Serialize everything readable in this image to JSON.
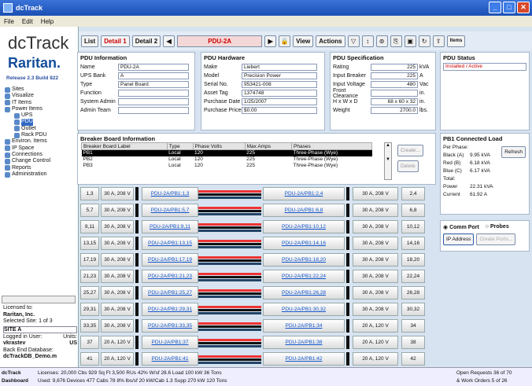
{
  "window": {
    "title": "dcTrack"
  },
  "menu": [
    "File",
    "Edit",
    "Help"
  ],
  "left": {
    "logo1": "dcTrack",
    "logo2": "Raritan.",
    "release": "Release 2.3 Build 822",
    "tree": [
      "Sites",
      "Visualize",
      "IT Items",
      "Power Items",
      "UPS",
      "PDU",
      "Outlet",
      "Rack PDU",
      "Environ. Items",
      "IP Space",
      "Connections",
      "Change Control",
      "Reports",
      "Administration"
    ],
    "licensed_to_label": "Licensed to:",
    "licensed_to": "Raritan, Inc.",
    "selected_site": "Selected Site: 1 of 3",
    "site": "SITE A",
    "logged_label": "Logged in User:",
    "logged_user": "vkrastev",
    "units_label": "Units:",
    "units": "US",
    "backend_label": "Back End Database:",
    "backend": "dcTrackDB_Demo.m"
  },
  "toolbar": {
    "list": "List",
    "detail1": "Detail 1",
    "detail2": "Detail 2",
    "pdu": "PDU-2A",
    "view": "View",
    "actions": "Actions",
    "items": "Items"
  },
  "pdu_info": {
    "title": "PDU Information",
    "fields": [
      [
        "Name",
        "PDU-2A"
      ],
      [
        "UPS Bank",
        "A"
      ],
      [
        "Type",
        "Panel Board"
      ],
      [
        "Function",
        ""
      ],
      [
        "System Admin",
        ""
      ],
      [
        "Admin Team",
        ""
      ]
    ]
  },
  "pdu_hw": {
    "title": "PDU Hardware",
    "fields": [
      [
        "Make",
        "Liebert"
      ],
      [
        "Model",
        "Precision Power"
      ],
      [
        "Serial No.",
        "953421-008"
      ],
      [
        "Asset Tag",
        "1374748"
      ],
      [
        "Purchase Date",
        "1/25/2007"
      ],
      [
        "Purchase Price",
        "$0.00"
      ]
    ]
  },
  "pdu_spec": {
    "title": "PDU Specification",
    "fields": [
      [
        "Rating",
        "225",
        "kVA"
      ],
      [
        "Input Breaker",
        "225",
        "A"
      ],
      [
        "Input Voltage",
        "480",
        "Vac"
      ],
      [
        "Front Clearance",
        "",
        "in."
      ],
      [
        "H x W x D",
        "68 x 60 x 32",
        "in."
      ],
      [
        "Weight",
        "2700.0",
        "lbs."
      ]
    ]
  },
  "pdu_status": {
    "title": "PDU Status",
    "value": "Installed / Active"
  },
  "bb": {
    "title": "Breaker Board Information",
    "headers": [
      "Breaker Board Label",
      "Type",
      "Phase Volts",
      "Max Amps",
      "Phases"
    ],
    "rows": [
      [
        "PB1",
        "Local",
        "120",
        "225",
        "Three-Phase (Wye)"
      ],
      [
        "PB2",
        "Local",
        "120",
        "225",
        "Three-Phase (Wye)"
      ],
      [
        "PB3",
        "Local",
        "120",
        "225",
        "Three-Phase (Wye)"
      ]
    ],
    "create": "Create...",
    "delete": "Delete"
  },
  "connected_load": {
    "title": "PB1 Connected Load",
    "per_phase": "Per Phase:",
    "refresh": "Refresh",
    "rows": [
      [
        "Black (A)",
        "9.95 kVA"
      ],
      [
        "Red (B)",
        "6.18 kVA"
      ],
      [
        "Blue (C)",
        "6.17 kVA"
      ]
    ],
    "total_label": "Total:",
    "power_label": "Power",
    "power": "22.31 kVA",
    "current_label": "Current",
    "current": "61.92 A"
  },
  "ports": {
    "comm": "Comm Port",
    "probes": "Probes",
    "ip": "IP Address",
    "create": "Create Ports..."
  },
  "breakers": [
    {
      "l": "1,3",
      "ls": "30 A, 208 V",
      "ll": "PDU-2A/PB1:1,3",
      "rl": "PDU-2A/PB1:2,4",
      "rs": "30 A, 208 V",
      "r": "2,4"
    },
    {
      "l": "5,7",
      "ls": "30 A, 208 V",
      "ll": "PDU-2A/PB1:5,7",
      "rl": "PDU-2A/PB1:6,8",
      "rs": "30 A, 208 V",
      "r": "6,8"
    },
    {
      "l": "9,11",
      "ls": "30 A, 208 V",
      "ll": "PDU-2A/PB1:9,11",
      "rl": "PDU-2A/PB1:10,12",
      "rs": "30 A, 208 V",
      "r": "10,12"
    },
    {
      "l": "13,15",
      "ls": "30 A, 208 V",
      "ll": "PDU-2A/PB1:13,15",
      "rl": "PDU-2A/PB1:14,16",
      "rs": "30 A, 208 V",
      "r": "14,16"
    },
    {
      "l": "17,19",
      "ls": "30 A, 208 V",
      "ll": "PDU-2A/PB1:17,19",
      "rl": "PDU-2A/PB1:18,20",
      "rs": "30 A, 208 V",
      "r": "18,20"
    },
    {
      "l": "21,23",
      "ls": "30 A, 208 V",
      "ll": "PDU-2A/PB1:21,23",
      "rl": "PDU-2A/PB1:22,24",
      "rs": "30 A, 208 V",
      "r": "22,24"
    },
    {
      "l": "25,27",
      "ls": "30 A, 208 V",
      "ll": "PDU-2A/PB1:25,27",
      "rl": "PDU-2A/PB1:26,28",
      "rs": "30 A, 208 V",
      "r": "26,28"
    },
    {
      "l": "29,31",
      "ls": "30 A, 208 V",
      "ll": "PDU-2A/PB1:29,31",
      "rl": "PDU-2A/PB1:30,32",
      "rs": "30 A, 208 V",
      "r": "30,32"
    },
    {
      "l": "33,35",
      "ls": "30 A, 208 V",
      "ll": "PDU-2A/PB1:33,35",
      "rl": "PDU-2A/PB1:34",
      "rs": "20 A, 120 V",
      "r": "34"
    },
    {
      "l": "37",
      "ls": "20 A, 120 V",
      "ll": "PDU-2A/PB1:37",
      "rl": "PDU-2A/PB1:38",
      "rs": "20 A, 120 V",
      "r": "38"
    },
    {
      "l": "41",
      "ls": "20 A, 120 V",
      "ll": "PDU-2A/PB1:41",
      "rl": "PDU-2A/PB1:42",
      "rs": "20 A, 120 V",
      "r": "42"
    }
  ],
  "status": {
    "app": "dcTrack",
    "dashboard": "Dashboard",
    "row1": "Licenses:  20,000   Cbs    929  Sq Ft     3,500  RUs  42%  W/sf     28.6  Load  100 kW   36 Tons",
    "row2": "Used:       9,676  Devices  477  Cabs    78   8%  lbs/sf  20   kW/Cab  1.3  Supp  270 kW  120 Tons",
    "req1": "Open Requests   36 of   70",
    "req2": "& Work Orders     5 of   26"
  }
}
